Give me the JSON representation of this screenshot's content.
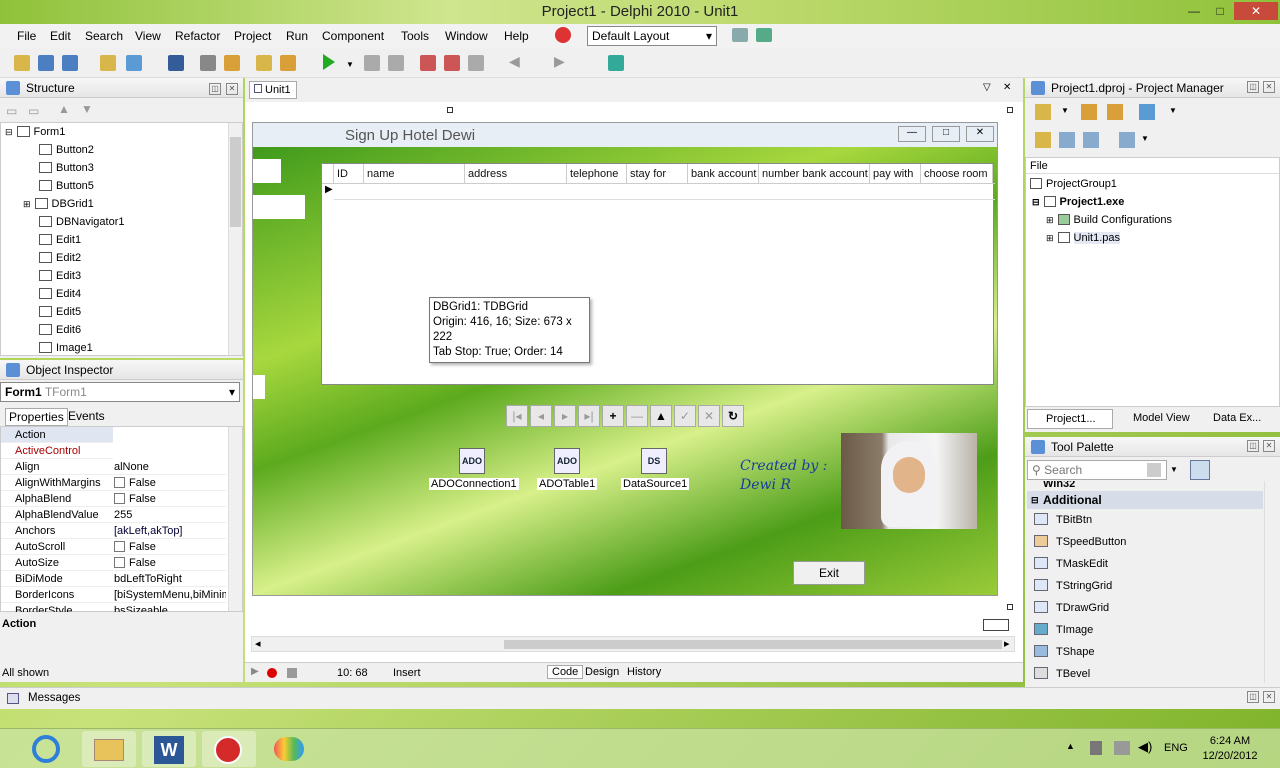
{
  "window": {
    "title": "Project1 - Delphi 2010 - Unit1",
    "min": "—",
    "max": "□",
    "close": "✕"
  },
  "menu": [
    "File",
    "Edit",
    "Search",
    "View",
    "Refactor",
    "Project",
    "Run",
    "Component",
    "Tools",
    "Window",
    "Help"
  ],
  "layout_combo": "Default Layout",
  "structure": {
    "title": "Structure",
    "nodes": [
      "Form1",
      "Button2",
      "Button3",
      "Button5",
      "DBGrid1",
      "DBNavigator1",
      "Edit1",
      "Edit2",
      "Edit3",
      "Edit4",
      "Edit5",
      "Edit6",
      "Image1"
    ]
  },
  "object_inspector": {
    "title": "Object Inspector",
    "object": "Form1",
    "object_type": "TForm1",
    "tabs": [
      "Properties",
      "Events"
    ],
    "props": [
      [
        "Action",
        ""
      ],
      [
        "ActiveControl",
        ""
      ],
      [
        "Align",
        "alNone"
      ],
      [
        "AlignWithMargins",
        "False"
      ],
      [
        "AlphaBlend",
        "False"
      ],
      [
        "AlphaBlendValue",
        "255"
      ],
      [
        "Anchors",
        "[akLeft,akTop]"
      ],
      [
        "AutoScroll",
        "False"
      ],
      [
        "AutoSize",
        "False"
      ],
      [
        "BiDiMode",
        "bdLeftToRight"
      ],
      [
        "BorderIcons",
        "[biSystemMenu,biMinim"
      ],
      [
        "BorderStyle",
        "bsSizeable"
      ]
    ],
    "footer": "Action",
    "status": "All shown"
  },
  "editor": {
    "tab": "Unit1",
    "form_title": "Sign Up Hotel Dewi",
    "grid_columns": [
      "ID",
      "name",
      "address",
      "telephone",
      "stay for",
      "bank account",
      "number bank account",
      "pay with",
      "choose room"
    ],
    "tooltip": [
      "DBGrid1: TDBGrid",
      "Origin: 416, 16; Size: 673 x 222",
      "Tab Stop: True; Order: 14"
    ],
    "nav_buttons": [
      "|◂",
      "◂",
      "▸",
      "▸|",
      "+",
      "—",
      "▲",
      "✓",
      "✕",
      "↻"
    ],
    "components": [
      {
        "name": "ADOConnection1",
        "icon": "ADO"
      },
      {
        "name": "ADOTable1",
        "icon": "ADO"
      },
      {
        "name": "DataSource1",
        "icon": "DS"
      }
    ],
    "created_by": [
      "Created by :",
      "Dewi R"
    ],
    "exit_button": "Exit",
    "status": {
      "position": "10: 68",
      "mode": "Insert"
    },
    "bottom_tabs": [
      "Code",
      "Design",
      "History"
    ]
  },
  "project_manager": {
    "title": "Project1.dproj - Project Manager",
    "header": "File",
    "nodes": [
      "ProjectGroup1",
      "Project1.exe",
      "Build Configurations",
      "Unit1.pas"
    ],
    "tabs": [
      "Project1...",
      "Model View",
      "Data Ex..."
    ]
  },
  "tool_palette": {
    "title": "Tool Palette",
    "search_placeholder": "Search",
    "category_prev": "Win32",
    "category": "Additional",
    "items": [
      "TBitBtn",
      "TSpeedButton",
      "TMaskEdit",
      "TStringGrid",
      "TDrawGrid",
      "TImage",
      "TShape",
      "TBevel"
    ]
  },
  "messages": "Messages",
  "taskbar": {
    "lang": "ENG",
    "time": "6:24 AM",
    "date": "12/20/2012"
  }
}
